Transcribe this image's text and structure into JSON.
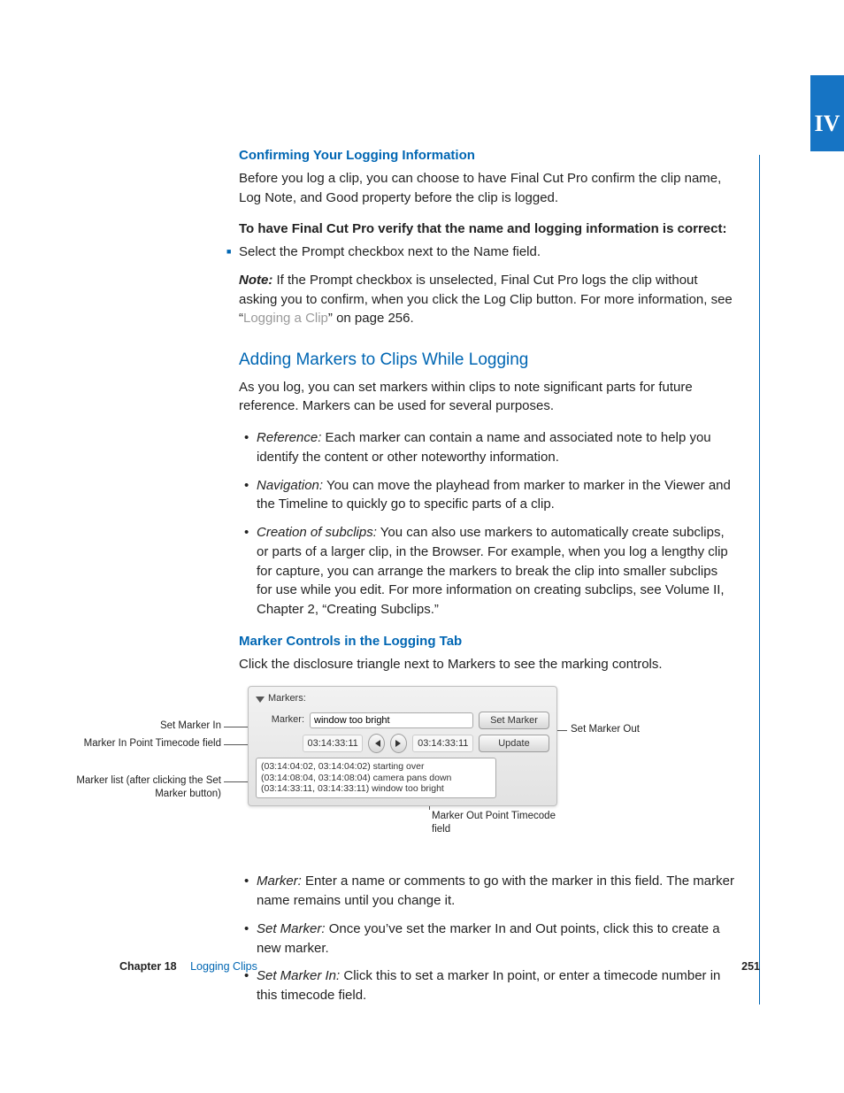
{
  "tab_label": "IV",
  "h3_confirm": "Confirming Your Logging Information",
  "p_confirm": "Before you log a clip, you can choose to have Final Cut Pro confirm the clip name, Log Note, and Good property before the clip is logged.",
  "p_verify_bold": "To have Final Cut Pro verify that the name and logging information is correct:",
  "step_select": "Select the Prompt checkbox next to the Name field.",
  "note_label": "Note:",
  "note_body_a": "  If the Prompt checkbox is unselected, Final Cut Pro logs the clip without asking you to confirm, when you click the Log Clip button. For more information, see “",
  "note_link": "Logging a Clip",
  "note_body_b": "” on page 256.",
  "h2_adding": "Adding Markers to Clips While Logging",
  "p_adding": "As you log, you can set markers within clips to note significant parts for future reference. Markers can be used for several purposes.",
  "bullets1": [
    {
      "lead": "Reference:",
      "text": "  Each marker can contain a name and associated note to help you identify the content or other noteworthy information."
    },
    {
      "lead": "Navigation:",
      "text": "  You can move the playhead from marker to marker in the Viewer and the Timeline to quickly go to specific parts of a clip."
    },
    {
      "lead": "Creation of subclips:",
      "text": "  You can also use markers to automatically create subclips, or parts of a larger clip, in the Browser. For example, when you log a lengthy clip for capture, you can arrange the markers to break the clip into smaller subclips for use while you edit. For more information on creating subclips, see Volume II, Chapter 2, “Creating Subclips.”"
    }
  ],
  "h3_marker_controls": "Marker Controls in the Logging Tab",
  "p_marker_controls": "Click the disclosure triangle next to Markers to see the marking controls.",
  "panel": {
    "header": "Markers:",
    "marker_label": "Marker:",
    "marker_value": "window too bright",
    "set_marker_btn": "Set Marker",
    "in_tc": "03:14:33:11",
    "out_tc": "03:14:33:11",
    "update_btn": "Update",
    "list": [
      "(03:14:04:02, 03:14:04:02) starting over",
      "(03:14:08:04, 03:14:08:04) camera pans down",
      "(03:14:33:11, 03:14:33:11) window too bright"
    ]
  },
  "callouts": {
    "set_marker_in": "Set Marker In",
    "in_tc_field": "Marker In Point Timecode field",
    "marker_list": "Marker list (after clicking the Set Marker button)",
    "set_marker_out": "Set Marker Out",
    "out_point": "Marker Out Point Timecode field"
  },
  "bullets2": [
    {
      "lead": "Marker:",
      "text": "  Enter a name or comments to go with the marker in this field. The marker name remains until you change it."
    },
    {
      "lead": "Set Marker:",
      "text": "  Once you’ve set the marker In and Out points, click this to create a new marker."
    },
    {
      "lead": "Set Marker In:",
      "text": "  Click this to set a marker In point, or enter a timecode number in this timecode field."
    }
  ],
  "footer": {
    "chapter_label": "Chapter 18",
    "chapter_title": "Logging Clips",
    "page": "251"
  }
}
